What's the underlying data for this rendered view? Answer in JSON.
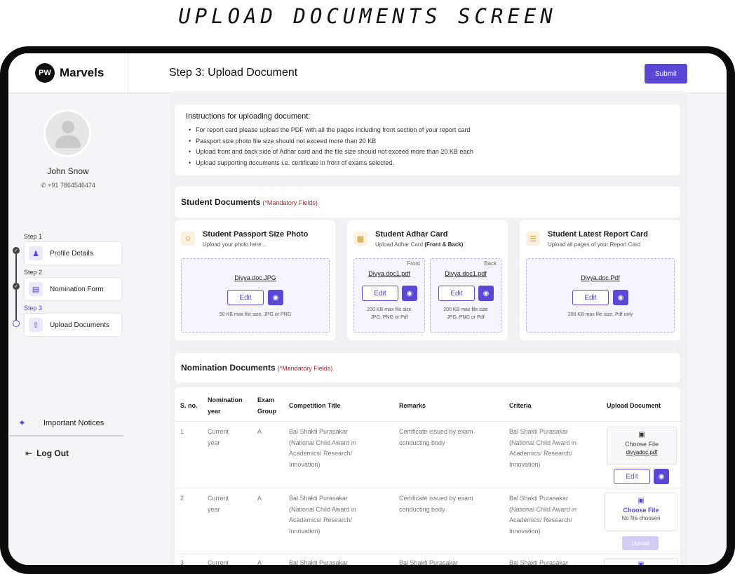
{
  "caption": "UPLOAD DOCUMENTS SCREEN",
  "brand": {
    "logo_mark": "PW",
    "name": "Marvels"
  },
  "user": {
    "name": "John Snow",
    "phone_icon": "phone-icon",
    "phone": "+91 7864546474"
  },
  "steps": [
    {
      "label": "Step 1",
      "title": "Profile Details",
      "icon": "user-icon",
      "status": "done"
    },
    {
      "label": "Step 2",
      "title": "Nomination Form",
      "icon": "form-icon",
      "status": "done"
    },
    {
      "label": "Step 3",
      "title": "Upload Documents",
      "icon": "upload-icon",
      "status": "current"
    }
  ],
  "sidebar_bottom": {
    "notices": "Important Notices",
    "logout": "Log Out"
  },
  "header": {
    "title": "Step 3: Upload Document",
    "submit": "Submit"
  },
  "instructions": {
    "title": "Instructions for uploading document:",
    "items": [
      "For report card please upload the PDF with all the pages including front section of your report card",
      "Passport size photo file size should not exceed more than 20 KB",
      "Upload front and back side of Adhar card and the file size should not exceed more than 20 KB each",
      "Upload supporting documents i.e. certificate in front of exams selected."
    ]
  },
  "student_docs": {
    "title": "Student Documents",
    "mandatory": "(*Mandatory Fields)",
    "photo": {
      "title": "Student Passport Size Photo",
      "sub": "Upload your photo here...",
      "file": "Divya.doc.JPG",
      "edit": "Edit",
      "hint": "50 KB max file size, JPG or PNG"
    },
    "adhar": {
      "title": "Student Adhar Card",
      "sub": "Upload Adhar Card",
      "sub_bold": "(Front & Back)",
      "front": {
        "side": "Front",
        "file": "Divya.doc1.pdf",
        "edit": "Edit",
        "hint1": "200 KB max file size",
        "hint2": "JPG, PNG or Pdf"
      },
      "back": {
        "side": "Back",
        "file": "Divya.doc1.pdf",
        "edit": "Edit",
        "hint1": "200 KB max file size",
        "hint2": "JPG, PNG or Pdf"
      }
    },
    "report": {
      "title": "Student Latest Report Card",
      "sub": "Upload all pages of your Report Card",
      "file": "Divya.doc.Pdf",
      "edit": "Edit",
      "hint": "200 KB max file size, Pdf only"
    }
  },
  "nomination": {
    "title": "Nomination Documents",
    "mandatory": "(*Mandatory Fields)",
    "headers": {
      "sno": "S. no.",
      "year1": "Nomination",
      "year2": "year",
      "group1": "Exam",
      "group2": "Group",
      "comp": "Competition Title",
      "remarks": "Remarks",
      "criteria": "Criteria",
      "upload": "Upload Document"
    },
    "rows": [
      {
        "sno": "1",
        "year1": "Current",
        "year2": "year",
        "group": "A",
        "comp": [
          "Bal Shakti Purasakar",
          "(National Child Award in",
          "Academics/ Research/",
          "Innovation)"
        ],
        "remarks": [
          "Certificate issued by exam",
          "conducting body"
        ],
        "criteria": [
          "Bal Shakti Purasakar",
          "(National Child Award in",
          "Academics/ Research/",
          "Innovation)"
        ],
        "choose": "Choose File",
        "file": "divyadoc.pdf",
        "edit": "Edit"
      },
      {
        "sno": "2",
        "year1": "Current",
        "year2": "year",
        "group": "A",
        "comp": [
          "Bal Shakti Purasakar",
          "(National Child Award in",
          "Academics/ Research/",
          "Innovation)"
        ],
        "remarks": [
          "Certificate issued by exam",
          "conducting body"
        ],
        "criteria": [
          "Bal Shakti Purasakar",
          "(National Child Award in",
          "Academics/ Research/",
          "Innovation)"
        ],
        "choose": "Choose File",
        "file": "No file choosen",
        "upload": "Upload"
      },
      {
        "sno": "3",
        "year1": "Current",
        "group": "A",
        "comp": "Bal Shakti Purasakar",
        "remarks": "Bal Shakti Purasakar",
        "criteria": "Bal Shakti Purasakar"
      }
    ]
  },
  "colors": {
    "accent": "#5b47d6",
    "mandatory": "#b0223a"
  }
}
